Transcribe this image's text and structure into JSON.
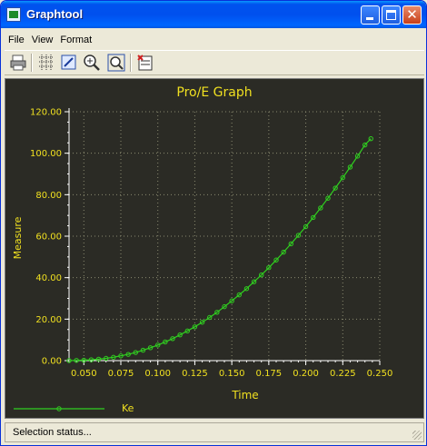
{
  "window": {
    "title": "Graphtool"
  },
  "menu": [
    {
      "label": "File"
    },
    {
      "label": "View"
    },
    {
      "label": "Format"
    }
  ],
  "toolbar": {
    "icons": [
      "print-icon",
      "grid-icon",
      "edit-graph-icon",
      "zoom-in-icon",
      "zoom-fit-icon",
      "export-table-icon"
    ]
  },
  "status": {
    "text": "Selection status..."
  },
  "colors": {
    "plot_bg": "#2b2b25",
    "axis_text": "#f0e020",
    "series": "#30d020",
    "grid": "#8a8a70"
  },
  "chart_data": {
    "type": "line",
    "title": "Pro/E Graph",
    "xlabel": "Time",
    "ylabel": "Measure",
    "xlim": [
      0.04,
      0.25
    ],
    "ylim": [
      0,
      120
    ],
    "x_ticks": [
      "0.050",
      "0.075",
      "0.100",
      "0.125",
      "0.150",
      "0.175",
      "0.200",
      "0.225",
      "0.250"
    ],
    "y_ticks": [
      "0.00",
      "20.00",
      "40.00",
      "60.00",
      "80.00",
      "100.00",
      "120.00"
    ],
    "grid": true,
    "legend_position": "bottom-left",
    "series": [
      {
        "name": "Ke",
        "points": [
          [
            0.04,
            0.0
          ],
          [
            0.045,
            0.1
          ],
          [
            0.05,
            0.2
          ],
          [
            0.055,
            0.4
          ],
          [
            0.06,
            0.7
          ],
          [
            0.065,
            1.1
          ],
          [
            0.07,
            1.6
          ],
          [
            0.075,
            2.3
          ],
          [
            0.08,
            3.0
          ],
          [
            0.085,
            3.9
          ],
          [
            0.09,
            5.0
          ],
          [
            0.095,
            6.2
          ],
          [
            0.1,
            7.5
          ],
          [
            0.105,
            9.0
          ],
          [
            0.11,
            10.6
          ],
          [
            0.115,
            12.4
          ],
          [
            0.12,
            14.3
          ],
          [
            0.125,
            16.3
          ],
          [
            0.13,
            18.5
          ],
          [
            0.135,
            20.8
          ],
          [
            0.14,
            23.3
          ],
          [
            0.145,
            26.0
          ],
          [
            0.15,
            28.8
          ],
          [
            0.155,
            31.7
          ],
          [
            0.16,
            34.7
          ],
          [
            0.165,
            38.0
          ],
          [
            0.17,
            41.3
          ],
          [
            0.175,
            44.8
          ],
          [
            0.18,
            48.5
          ],
          [
            0.185,
            52.3
          ],
          [
            0.19,
            56.3
          ],
          [
            0.195,
            60.4
          ],
          [
            0.2,
            64.6
          ],
          [
            0.205,
            69.0
          ],
          [
            0.21,
            73.6
          ],
          [
            0.215,
            78.3
          ],
          [
            0.22,
            83.2
          ],
          [
            0.225,
            88.2
          ],
          [
            0.23,
            93.3
          ],
          [
            0.235,
            98.6
          ],
          [
            0.24,
            104.0
          ],
          [
            0.244,
            107.0
          ]
        ]
      }
    ]
  }
}
